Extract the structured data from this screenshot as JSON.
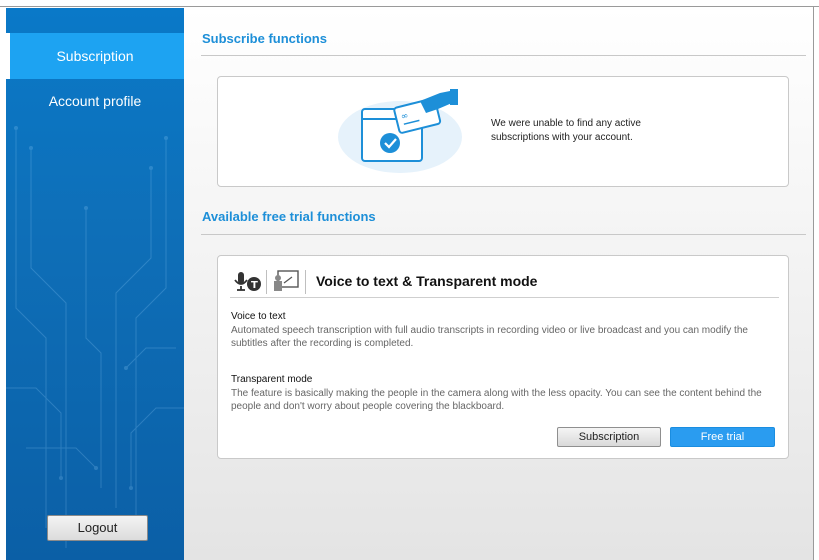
{
  "sidebar": {
    "items": [
      {
        "label": "Subscription",
        "active": true
      },
      {
        "label": "Account profile",
        "active": false
      }
    ],
    "logout_label": "Logout"
  },
  "subscribe": {
    "title": "Subscribe functions",
    "empty_message": "We were unable to find any active subscriptions with your account."
  },
  "trials": {
    "title": "Available free trial functions",
    "card": {
      "title": "Voice to text & Transparent mode",
      "icons": [
        "microphone-text-icon",
        "presenter-transparent-icon"
      ],
      "features": [
        {
          "name": "Voice to text",
          "description": "Automated speech transcription with full audio transcripts in recording video or live broadcast and you can modify the subtitles after the recording is completed."
        },
        {
          "name": "Transparent mode",
          "description": "The feature is basically making the people in the camera along with the less opacity. You can see the content behind the people and don't worry about people covering the blackboard."
        }
      ],
      "subscription_label": "Subscription",
      "free_trial_label": "Free trial"
    }
  },
  "colors": {
    "sidebar": "#0b6fb8",
    "active_item": "#1da3f2",
    "section_title": "#1d8fd8",
    "primary_button": "#2a9cf0"
  }
}
